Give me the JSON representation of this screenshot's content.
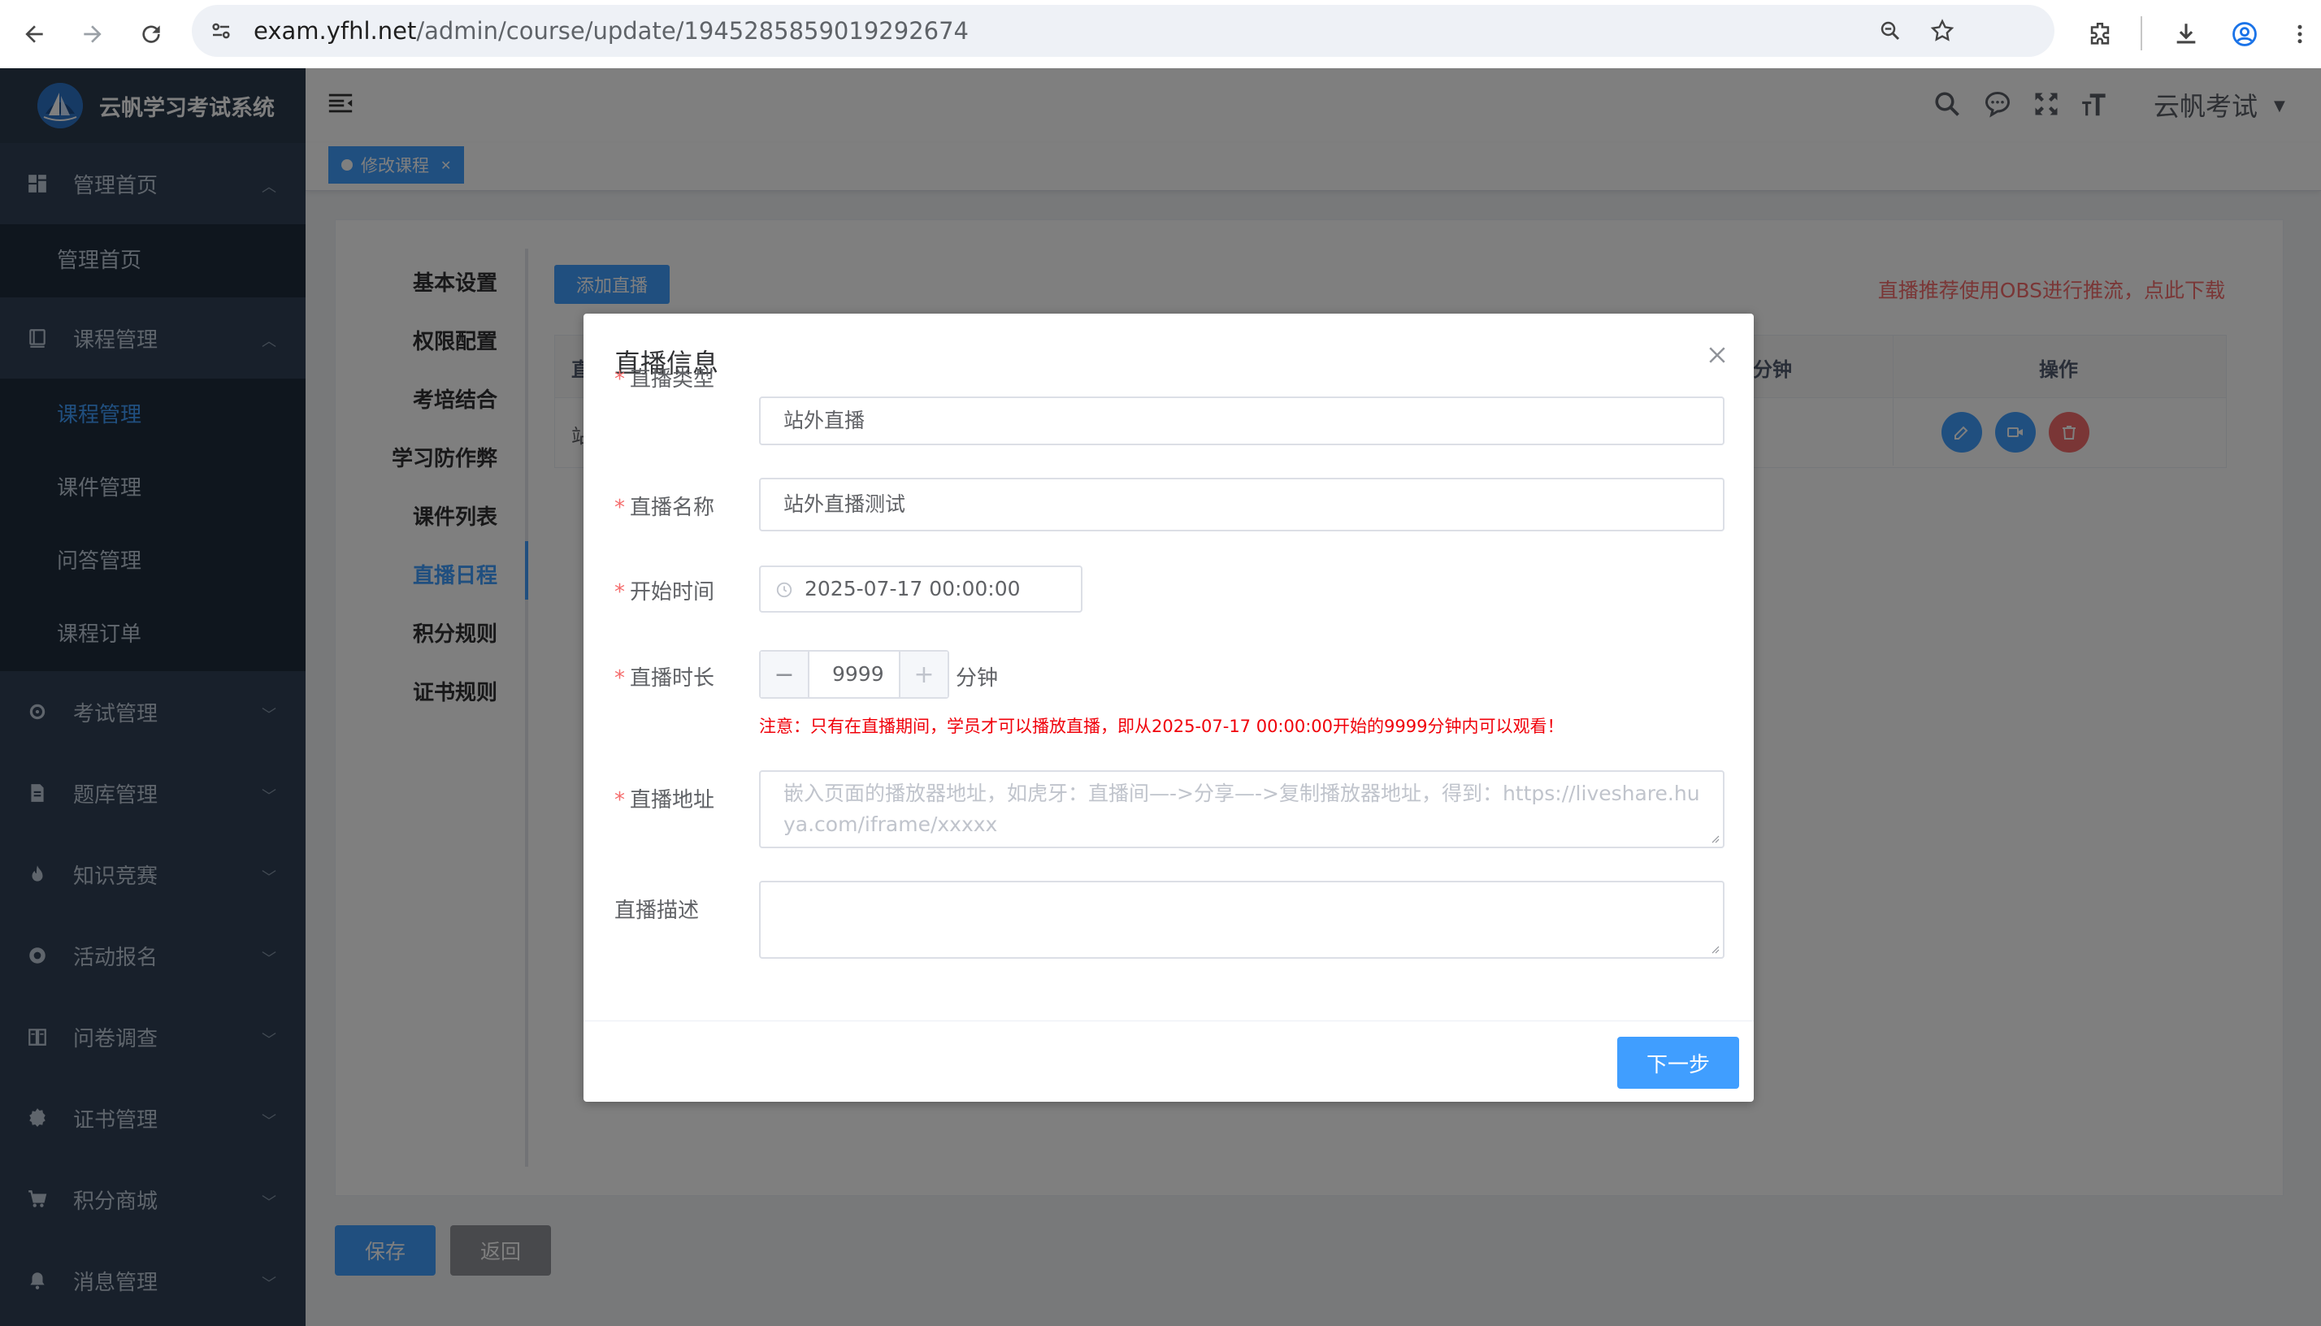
{
  "browser": {
    "url_host": "exam.yfhl.net",
    "url_path": "/admin/course/update/1945285859019292674"
  },
  "sidebar": {
    "brand": "云帆学习考试系统",
    "items": [
      {
        "label": "管理首页",
        "icon": "dashboard-icon",
        "expanded": true,
        "children": [
          {
            "label": "管理首页",
            "active": false
          }
        ]
      },
      {
        "label": "课程管理",
        "icon": "book-icon",
        "expanded": true,
        "children": [
          {
            "label": "课程管理",
            "active": true
          },
          {
            "label": "课件管理",
            "active": false
          },
          {
            "label": "问答管理",
            "active": false
          },
          {
            "label": "课程订单",
            "active": false
          }
        ]
      },
      {
        "label": "考试管理",
        "icon": "exam-icon",
        "expanded": false
      },
      {
        "label": "题库管理",
        "icon": "question-bank-icon",
        "expanded": false
      },
      {
        "label": "知识竞赛",
        "icon": "fire-icon",
        "expanded": false
      },
      {
        "label": "活动报名",
        "icon": "activity-icon",
        "expanded": false
      },
      {
        "label": "问卷调查",
        "icon": "survey-icon",
        "expanded": false
      },
      {
        "label": "证书管理",
        "icon": "certificate-icon",
        "expanded": false
      },
      {
        "label": "积分商城",
        "icon": "cart-icon",
        "expanded": false
      },
      {
        "label": "消息管理",
        "icon": "bell-icon",
        "expanded": false
      }
    ]
  },
  "navbar": {
    "user": "云帆考试"
  },
  "tags": [
    {
      "label": "修改课程"
    }
  ],
  "course_tabs": [
    "基本设置",
    "权限配置",
    "考培结合",
    "学习防作弊",
    "课件列表",
    "直播日程",
    "积分规则",
    "证书规则"
  ],
  "active_tab": "直播日程",
  "live": {
    "add_button": "添加直播",
    "obs_link": "直播推荐使用OBS进行推流，点此下载",
    "table": {
      "headers": [
        "直",
        "分钟",
        "操作"
      ],
      "rows": [
        {
          "first": "站"
        }
      ]
    }
  },
  "footer": {
    "save": "保存",
    "back": "返回"
  },
  "dialog": {
    "title": "直播信息",
    "fields": {
      "type": {
        "label": "直播类型",
        "value": "站外直播",
        "required": true
      },
      "name": {
        "label": "直播名称",
        "value": "站外直播测试",
        "required": true
      },
      "start": {
        "label": "开始时间",
        "value": "2025-07-17 00:00:00",
        "required": true
      },
      "duration": {
        "label": "直播时长",
        "value": "9999",
        "unit": "分钟",
        "minus": "−",
        "plus": "+",
        "required": true
      },
      "address": {
        "label": "直播地址",
        "placeholder": "嵌入页面的播放器地址，如虎牙：直播间—->分享—->复制播放器地址，得到：https://liveshare.huya.com/iframe/xxxxx",
        "required": true
      },
      "desc": {
        "label": "直播描述",
        "value": "",
        "required": false
      }
    },
    "note": "注意：只有在直播期间，学员才可以播放直播，即从2025-07-17 00:00:00开始的9999分钟内可以观看！",
    "next_button": "下一步"
  },
  "colors": {
    "primary": "#409eff",
    "sidebar_bg": "#304156",
    "danger": "#f56c6c"
  }
}
